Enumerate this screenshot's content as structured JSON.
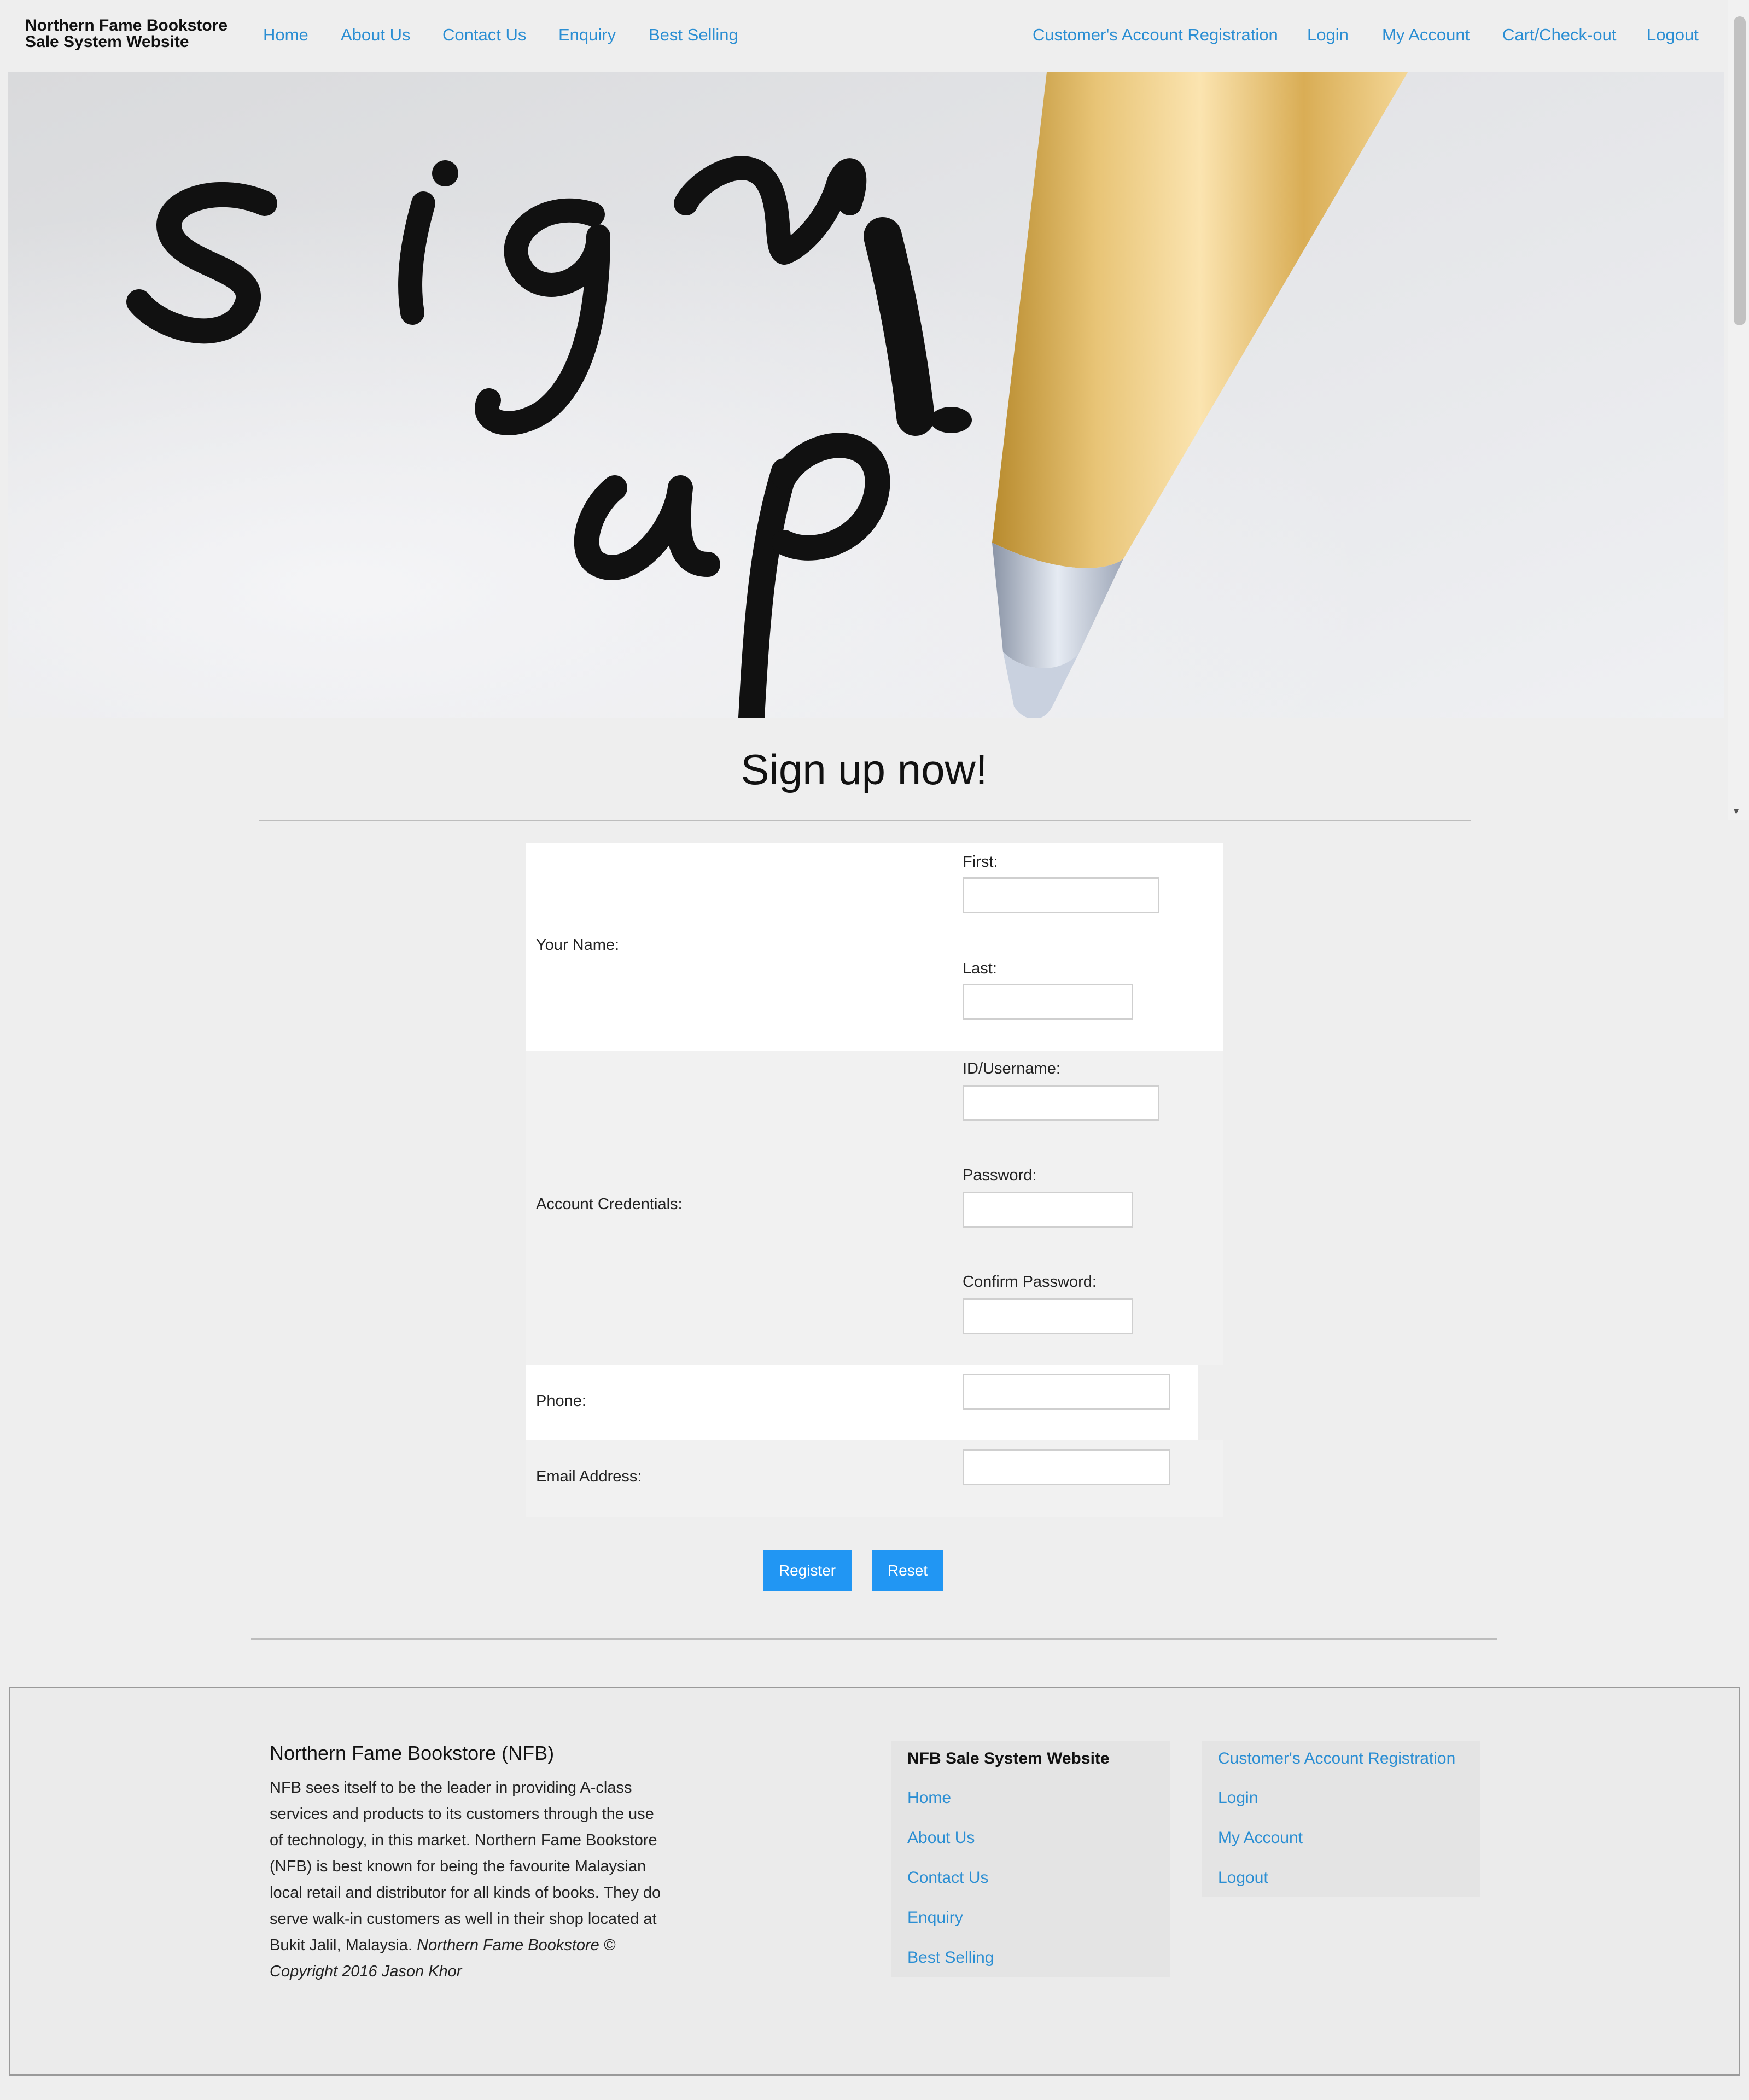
{
  "nav": {
    "brand_line1": "Northern Fame Bookstore",
    "brand_line2": "Sale System Website",
    "links_left": [
      "Home",
      "About Us",
      "Contact Us",
      "Enquiry",
      "Best Selling"
    ],
    "links_right": [
      "Customer's Account Registration",
      "Login",
      "My Account",
      "Cart/Check-out",
      "Logout"
    ]
  },
  "hero": {
    "image": "sign-up-handwriting-with-pen"
  },
  "heading": "Sign up now!",
  "form": {
    "name": {
      "label": "Your Name:",
      "first_label": "First:",
      "last_label": "Last:"
    },
    "credentials": {
      "label": "Account Credentials:",
      "username_label": "ID/Username:",
      "password_label": "Password:",
      "confirm_label": "Confirm Password:"
    },
    "phone_label": "Phone:",
    "email_label": "Email Address:",
    "register": "Register",
    "reset": "Reset"
  },
  "footer": {
    "title": "Northern Fame Bookstore (NFB)",
    "description": "NFB sees itself to be the leader in providing A-class services and products to its customers through the use of technology, in this market. Northern Fame Bookstore (NFB) is best known for being the favourite Malaysian local retail and distributor for all kinds of books. They do serve walk-in customers as well in their shop located at Bukit Jalil, Malaysia.",
    "copyright": "Northern Fame Bookstore © Copyright 2016 Jason Khor",
    "menu1_title": "NFB Sale System Website",
    "menu1": [
      "Home",
      "About Us",
      "Contact Us",
      "Enquiry",
      "Best Selling"
    ],
    "menu2": [
      "Customer's Account Registration",
      "Login",
      "My Account",
      "Logout"
    ]
  },
  "colors": {
    "link": "#2a8ed3",
    "button": "#2196f3",
    "background": "#eeeeee"
  }
}
